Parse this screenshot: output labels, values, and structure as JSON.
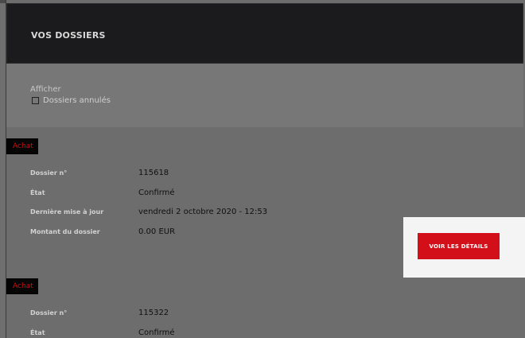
{
  "header": {
    "title": "VOS DOSSIERS"
  },
  "filter": {
    "label": "Afficher",
    "checkbox_label": "Dossiers annulés",
    "checked": false
  },
  "dossiers": [
    {
      "tag": "Achat",
      "rows": [
        {
          "label": "Dossier n°",
          "value": "115618"
        },
        {
          "label": "État",
          "value": "Confirmé"
        },
        {
          "label": "Dernière mise à jour",
          "value": "vendredi 2 octobre 2020 - 12:53"
        },
        {
          "label": "Montant du dossier",
          "value": "0.00 EUR"
        }
      ],
      "button": "VOIR LES DÉTAILS"
    },
    {
      "tag": "Achat",
      "rows": [
        {
          "label": "Dossier n°",
          "value": "115322"
        },
        {
          "label": "État",
          "value": "Confirmé"
        }
      ]
    }
  ],
  "colors": {
    "accent": "#d3101a",
    "header_bg": "#1b1b1d",
    "tag_text": "#cc1111"
  }
}
